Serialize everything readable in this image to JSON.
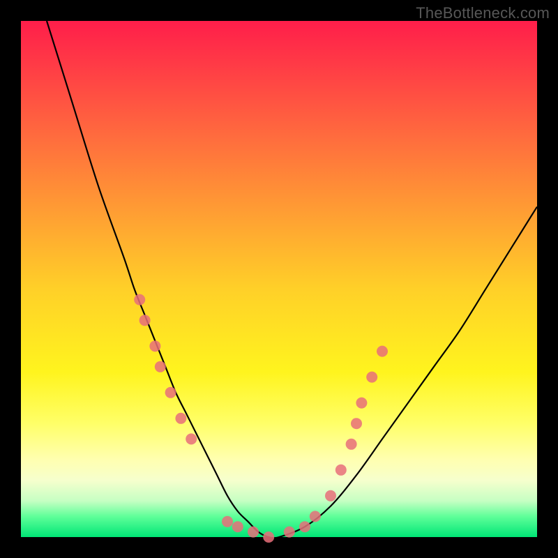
{
  "watermark": "TheBottleneck.com",
  "colors": {
    "background": "#000000",
    "curve_stroke": "#000000",
    "dot_fill": "#e86f7a",
    "gradient_top": "#ff1e4a",
    "gradient_bottom": "#00e676"
  },
  "chart_data": {
    "type": "line",
    "title": "",
    "xlabel": "",
    "ylabel": "",
    "xlim": [
      0,
      100
    ],
    "ylim": [
      0,
      100
    ],
    "grid": false,
    "series": [
      {
        "name": "bottleneck-curve",
        "x": [
          5,
          10,
          15,
          20,
          22,
          24,
          26,
          28,
          30,
          32,
          34,
          36,
          38,
          40,
          42,
          44,
          46,
          48,
          50,
          55,
          60,
          65,
          70,
          75,
          80,
          85,
          90,
          95,
          100
        ],
        "y": [
          100,
          84,
          68,
          54,
          48,
          43,
          38,
          33,
          28,
          24,
          20,
          16,
          12,
          8,
          5,
          3,
          1,
          0,
          0,
          2,
          6,
          12,
          19,
          26,
          33,
          40,
          48,
          56,
          64
        ]
      }
    ],
    "markers": [
      {
        "x": 23,
        "y": 46
      },
      {
        "x": 24,
        "y": 42
      },
      {
        "x": 26,
        "y": 37
      },
      {
        "x": 27,
        "y": 33
      },
      {
        "x": 29,
        "y": 28
      },
      {
        "x": 31,
        "y": 23
      },
      {
        "x": 33,
        "y": 19
      },
      {
        "x": 40,
        "y": 3
      },
      {
        "x": 42,
        "y": 2
      },
      {
        "x": 45,
        "y": 1
      },
      {
        "x": 48,
        "y": 0
      },
      {
        "x": 52,
        "y": 1
      },
      {
        "x": 55,
        "y": 2
      },
      {
        "x": 57,
        "y": 4
      },
      {
        "x": 60,
        "y": 8
      },
      {
        "x": 62,
        "y": 13
      },
      {
        "x": 64,
        "y": 18
      },
      {
        "x": 65,
        "y": 22
      },
      {
        "x": 66,
        "y": 26
      },
      {
        "x": 68,
        "y": 31
      },
      {
        "x": 70,
        "y": 36
      }
    ]
  }
}
